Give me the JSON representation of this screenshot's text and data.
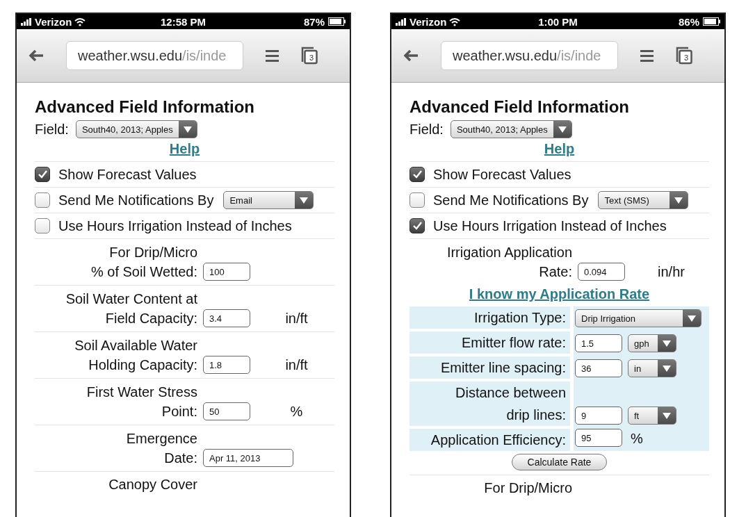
{
  "phones": [
    {
      "status": {
        "carrier": "Verizon",
        "time": "12:58 PM",
        "battery": "87%"
      },
      "browser": {
        "domain": "weather.wsu.edu",
        "path": "/is/inde",
        "tab_count": "3"
      },
      "page": {
        "title": "Advanced Field Information",
        "field_label": "Field:",
        "field_value": "South40, 2013; Apples",
        "help": "Help",
        "rows": [
          {
            "kind": "check",
            "label": "Show Forecast Values",
            "checked": true
          },
          {
            "kind": "check",
            "label": "Send Me Notifications By",
            "checked": false,
            "select": "Email"
          },
          {
            "kind": "check",
            "label": "Use Hours Irrigation Instead of Inches",
            "checked": false
          },
          {
            "kind": "input",
            "label_top": "For Drip/Micro",
            "label": "% of Soil Wetted:",
            "value": "100"
          },
          {
            "kind": "input",
            "label_top": "Soil Water Content at",
            "label": "Field Capacity:",
            "value": "3.4",
            "unit": "in/ft"
          },
          {
            "kind": "input",
            "label_top": "Soil Available Water",
            "label": "Holding Capacity:",
            "value": "1.8",
            "unit": "in/ft"
          },
          {
            "kind": "input",
            "label_top": "First Water Stress",
            "label": "Point:",
            "value": "50",
            "unit": "%"
          },
          {
            "kind": "date",
            "label_top": "Emergence",
            "label": "Date:",
            "value": "Apr 11, 2013"
          },
          {
            "kind": "heading",
            "label": "Canopy Cover"
          }
        ]
      }
    },
    {
      "status": {
        "carrier": "Verizon",
        "time": "1:00 PM",
        "battery": "86%"
      },
      "browser": {
        "domain": "weather.wsu.edu",
        "path": "/is/inde",
        "tab_count": "3"
      },
      "page": {
        "title": "Advanced Field Information",
        "field_label": "Field:",
        "field_value": "South40, 2013; Apples",
        "help": "Help",
        "rows": [
          {
            "kind": "check",
            "label": "Show Forecast Values",
            "checked": true
          },
          {
            "kind": "check",
            "label": "Send Me Notifications By",
            "checked": false,
            "select": "Text (SMS)"
          },
          {
            "kind": "check",
            "label": "Use Hours Irrigation Instead of Inches",
            "checked": true
          },
          {
            "kind": "input",
            "label_top": "Irrigation Application",
            "label": "Rate:",
            "value": "0.094",
            "unit": "in/hr"
          },
          {
            "kind": "link",
            "label": "I know my Application Rate"
          },
          {
            "kind": "panel",
            "rows": [
              {
                "label": "Irrigation Type:",
                "select": "Drip Irrigation"
              },
              {
                "label": "Emitter flow rate:",
                "value": "1.5",
                "select": "gph"
              },
              {
                "label": "Emitter line spacing:",
                "value": "36",
                "select": "in"
              },
              {
                "label_top": "Distance between",
                "label": "drip lines:",
                "value": "9",
                "select": "ft"
              },
              {
                "label": "Application Efficiency:",
                "value": "95",
                "unit": "%"
              }
            ]
          },
          {
            "kind": "button",
            "label": "Calculate Rate"
          },
          {
            "kind": "heading",
            "label": "For Drip/Micro"
          }
        ]
      }
    }
  ]
}
